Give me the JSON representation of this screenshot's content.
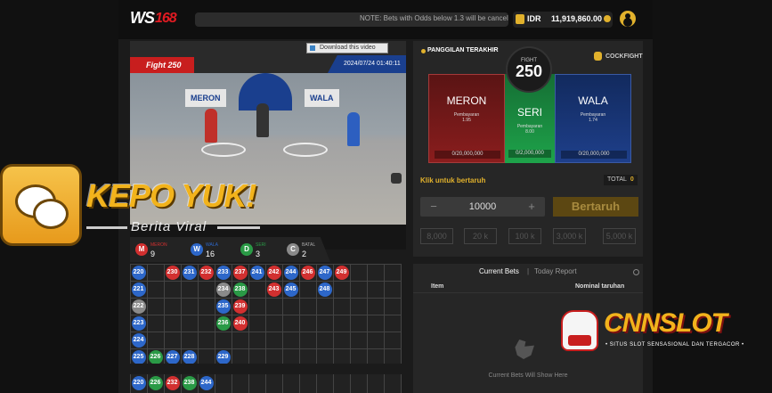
{
  "header": {
    "logo_ws": "WS",
    "logo_num": "168",
    "marquee": "NOTE: Bets with Odds below 1.3 will be cancelled",
    "currency": "IDR",
    "balance": "11,919,860.00"
  },
  "video": {
    "download_label": "Download this video",
    "fight_label": "Fight 250",
    "timestamp": "2024/07/24 01:40:11",
    "banner_left": "MERON",
    "banner_right": "WALA"
  },
  "panel": {
    "title": "PANGGILAN TERAKHIR",
    "category": "COCKFIGHT",
    "fight_label": "FIGHT",
    "fight_number": "250",
    "meron": {
      "name": "MERON",
      "payout_label": "Pembayaran",
      "odds": "1.95",
      "limit": "0/20,000,000"
    },
    "seri": {
      "name": "SERI",
      "payout_label": "Pembayaran",
      "odds": "8.00",
      "limit": "0/2,000,000"
    },
    "wala": {
      "name": "WALA",
      "payout_label": "Pembayaran",
      "odds": "1.74",
      "limit": "0/20,000,000"
    },
    "click_to_bet": "Klik untuk bertaruh",
    "total_label": "TOTAL",
    "total_value": "0",
    "amount": "10000",
    "minus": "−",
    "plus": "+",
    "bet_button": "Bertaruh",
    "chips": [
      "8,000",
      "20 k",
      "100 k",
      "3,000 k",
      "5,000 k"
    ]
  },
  "stats": [
    {
      "letter": "M",
      "name": "MERON",
      "count": "9",
      "color": "#d23030"
    },
    {
      "letter": "W",
      "name": "WALA",
      "count": "16",
      "color": "#2d67c9"
    },
    {
      "letter": "D",
      "name": "SERI",
      "count": "3",
      "color": "#2a9a46"
    },
    {
      "letter": "C",
      "name": "BATAL",
      "count": "2",
      "color": "#8a8a8a"
    }
  ],
  "colors": {
    "meron": "#d23030",
    "wala": "#2d67c9",
    "seri": "#2a9a46",
    "batal": "#8a8a8a",
    "accent": "#e1b12c"
  },
  "road": [
    [
      {
        "n": "220",
        "c": "wala"
      },
      {
        "n": "221",
        "c": "wala"
      },
      {
        "n": "222",
        "c": "batal"
      },
      {
        "n": "223",
        "c": "wala"
      },
      {
        "n": "224",
        "c": "wala"
      },
      {
        "n": "225",
        "c": "wala"
      }
    ],
    [
      null,
      null,
      null,
      null,
      null,
      {
        "n": "226",
        "c": "seri"
      }
    ],
    [
      {
        "n": "230",
        "c": "meron"
      },
      null,
      null,
      null,
      null,
      {
        "n": "227",
        "c": "wala"
      }
    ],
    [
      {
        "n": "231",
        "c": "wala"
      },
      null,
      null,
      null,
      null,
      {
        "n": "228",
        "c": "wala"
      }
    ],
    [
      {
        "n": "232",
        "c": "meron"
      },
      null,
      null,
      null,
      null,
      null
    ],
    [
      {
        "n": "233",
        "c": "wala"
      },
      {
        "n": "234",
        "c": "batal"
      },
      {
        "n": "235",
        "c": "wala"
      },
      {
        "n": "236",
        "c": "seri"
      },
      null,
      {
        "n": "229",
        "c": "wala"
      }
    ],
    [
      {
        "n": "237",
        "c": "meron"
      },
      {
        "n": "238",
        "c": "seri"
      },
      {
        "n": "239",
        "c": "meron"
      },
      {
        "n": "240",
        "c": "meron"
      },
      null,
      null
    ],
    [
      {
        "n": "241",
        "c": "wala"
      },
      null,
      null,
      null,
      null,
      null
    ],
    [
      {
        "n": "242",
        "c": "meron"
      },
      {
        "n": "243",
        "c": "meron"
      },
      null,
      null,
      null,
      null
    ],
    [
      {
        "n": "244",
        "c": "wala"
      },
      {
        "n": "245",
        "c": "wala"
      },
      null,
      null,
      null,
      null
    ],
    [
      {
        "n": "246",
        "c": "meron"
      },
      null,
      null,
      null,
      null,
      null
    ],
    [
      {
        "n": "247",
        "c": "wala"
      },
      {
        "n": "248",
        "c": "wala"
      },
      null,
      null,
      null,
      null
    ],
    [
      {
        "n": "249",
        "c": "meron"
      },
      null,
      null,
      null,
      null,
      null
    ]
  ],
  "road2": [
    {
      "n": "220",
      "c": "wala"
    },
    {
      "n": "226",
      "c": "seri"
    },
    {
      "n": "232",
      "c": "meron"
    },
    {
      "n": "238",
      "c": "seri"
    },
    {
      "n": "244",
      "c": "wala"
    }
  ],
  "bets": {
    "tab_current": "Current Bets",
    "tab_sep": "|",
    "tab_today": "Today Report",
    "col_item": "Item",
    "col_amount": "Nominal taruhan",
    "empty": "Current Bets Will Show Here"
  },
  "overlay": {
    "kepo": "KEPO YUK!",
    "berita": "Berita Viral",
    "cnn": "CNNSLOT",
    "cnn_sub": "• SITUS SLOT SENSASIONAL DAN TERGACOR •"
  }
}
